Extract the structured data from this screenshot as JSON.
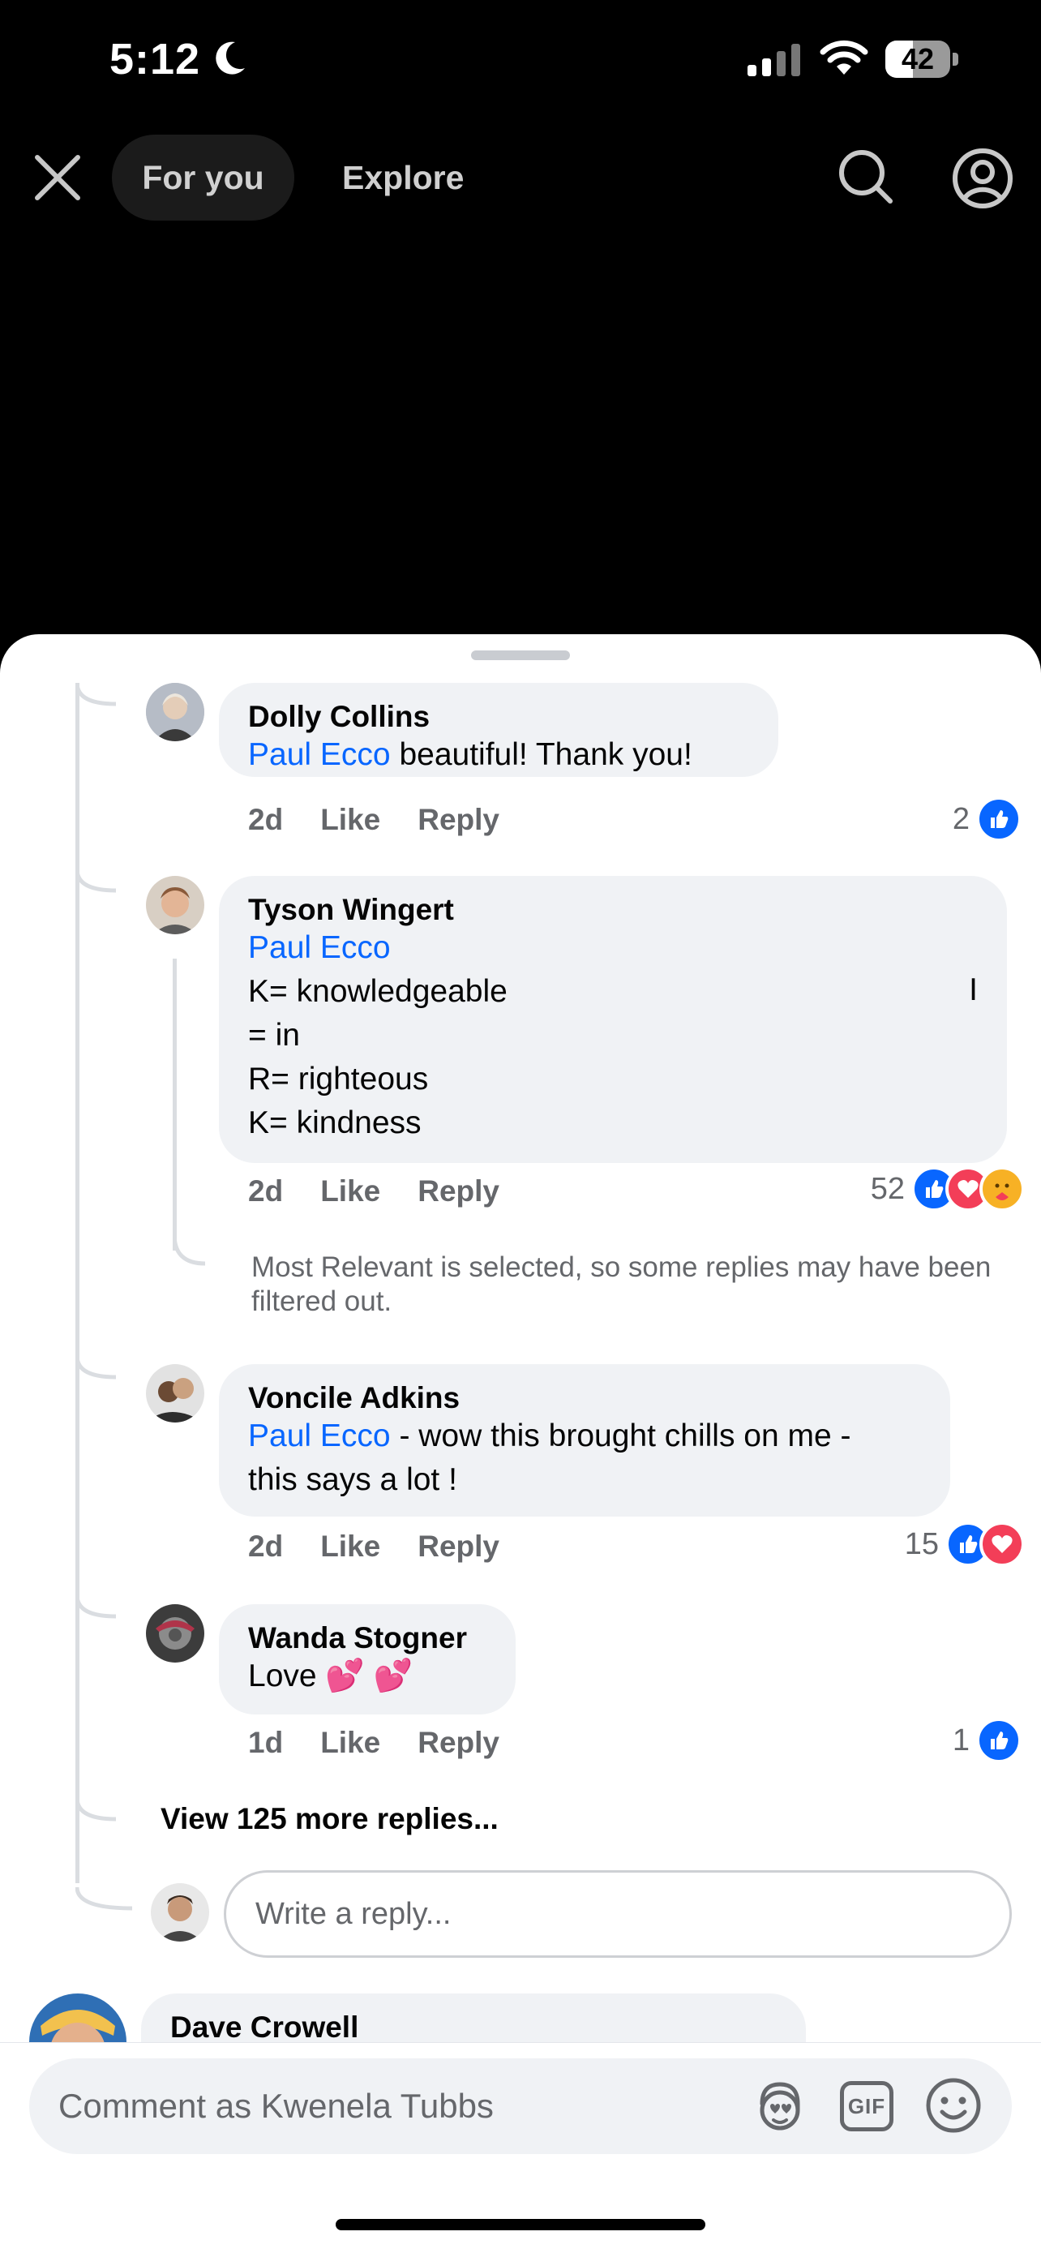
{
  "status_bar": {
    "time": "5:12",
    "battery": "42",
    "battery_level": 0.42
  },
  "nav": {
    "tabs": [
      {
        "label": "For you",
        "selected": true
      },
      {
        "label": "Explore",
        "selected": false
      }
    ]
  },
  "comments": [
    {
      "author": "Dolly Collins",
      "mention": "Paul Ecco",
      "text": " beautiful!  Thank you!",
      "time": "2d",
      "like": "Like",
      "reply": "Reply",
      "reactions": "2"
    },
    {
      "author": "Tyson Wingert",
      "mention": "Paul Ecco",
      "lines": [
        "K= knowledgeable",
        "= in",
        "R= righteous",
        "K= kindness"
      ],
      "stray_char": "I",
      "time": "2d",
      "like": "Like",
      "reply": "Reply",
      "reactions": "52",
      "filter_note": "Most Relevant is selected, so some replies may have been filtered out."
    },
    {
      "author": "Voncile Adkins",
      "mention": "Paul Ecco",
      "text": " - wow this brought chills on me -",
      "line2": "this says a lot !",
      "time": "2d",
      "like": "Like",
      "reply": "Reply",
      "reactions": "15"
    },
    {
      "author": "Wanda Stogner",
      "text": "Love 💕 💕",
      "time": "1d",
      "like": "Like",
      "reply": "Reply",
      "reactions": "1"
    }
  ],
  "view_more": "View 125 more replies...",
  "reply_placeholder": "Write a reply...",
  "next_comment_author": "Dave Crowell",
  "composer_placeholder": "Comment as Kwenela Tubbs",
  "composer_gif": "GIF",
  "colors": {
    "mention": "#0866ff",
    "like": "#0866ff",
    "love": "#f33e58"
  }
}
